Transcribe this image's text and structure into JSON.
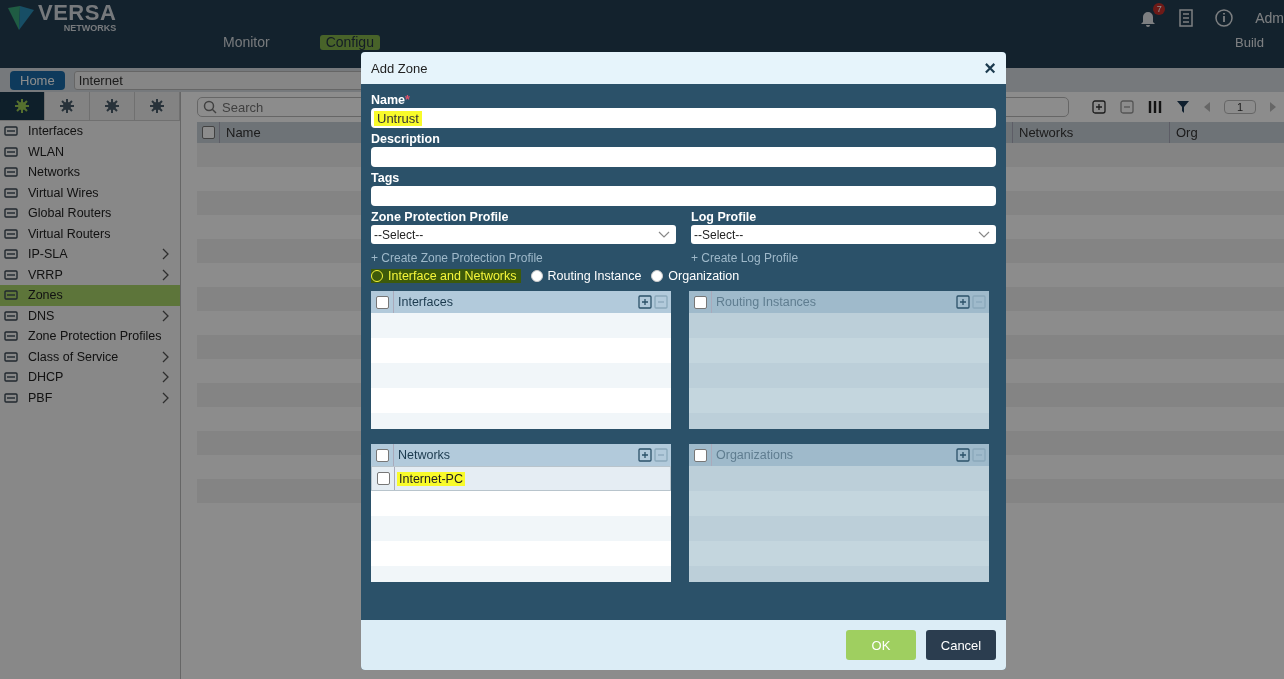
{
  "header": {
    "logo": "VERSA",
    "logo_sub": "NETWORKS",
    "notifications": "7",
    "user": "Adm",
    "nav": [
      {
        "label": "Monitor",
        "selected": false
      },
      {
        "label": "Configu",
        "selected": true
      }
    ],
    "build": "Build"
  },
  "breadcrumb": {
    "home": "Home",
    "appliance": "Internet"
  },
  "sidebar": {
    "tabs": [
      {
        "selected": true
      },
      {
        "selected": false
      },
      {
        "selected": false
      },
      {
        "selected": false
      }
    ],
    "items": [
      {
        "label": "Interfaces",
        "submenu": false,
        "selected": false
      },
      {
        "label": "WLAN",
        "submenu": false,
        "selected": false
      },
      {
        "label": "Networks",
        "submenu": false,
        "selected": false
      },
      {
        "label": "Virtual Wires",
        "submenu": false,
        "selected": false
      },
      {
        "label": "Global Routers",
        "submenu": false,
        "selected": false
      },
      {
        "label": "Virtual Routers",
        "submenu": false,
        "selected": false
      },
      {
        "label": "IP-SLA",
        "submenu": true,
        "selected": false
      },
      {
        "label": "VRRP",
        "submenu": true,
        "selected": false
      },
      {
        "label": "Zones",
        "submenu": false,
        "selected": true
      },
      {
        "label": "DNS",
        "submenu": true,
        "selected": false
      },
      {
        "label": "Zone Protection Profiles",
        "submenu": false,
        "selected": false
      },
      {
        "label": "Class of Service",
        "submenu": true,
        "selected": false
      },
      {
        "label": "DHCP",
        "submenu": true,
        "selected": false
      },
      {
        "label": "PBF",
        "submenu": true,
        "selected": false
      }
    ]
  },
  "main": {
    "search": {
      "placeholder": "Search"
    },
    "page": "1",
    "select_all_checked": false,
    "columns": [
      "Name",
      "Networks",
      "Org"
    ]
  },
  "dialog": {
    "title": "Add Zone",
    "close": "×",
    "name": {
      "label": "Name",
      "required_mark": "*",
      "value": "Untrust",
      "highlight": true
    },
    "description": {
      "label": "Description"
    },
    "tags": {
      "label": "Tags"
    },
    "selects": [
      {
        "label": "Zone Protection Profile",
        "value": "--Select--",
        "link": "+ Create Zone Protection Profile"
      },
      {
        "label": "Log Profile",
        "value": "--Select--",
        "link": "+ Create Log Profile"
      }
    ],
    "radios": [
      {
        "label": "Interface and Networks",
        "selected": true,
        "highlight": true
      },
      {
        "label": "Routing Instance",
        "selected": false,
        "highlight": false
      },
      {
        "label": "Organization",
        "selected": false,
        "highlight": false
      }
    ],
    "lists": [
      {
        "title": "Interfaces",
        "disabled": false,
        "checked": false
      },
      {
        "title": "Routing Instances",
        "disabled": true,
        "checked": false
      },
      {
        "title": "Networks",
        "disabled": false,
        "checked": false,
        "rows": [
          {
            "label": "Internet-PC",
            "highlight": true,
            "checked": false
          }
        ]
      },
      {
        "title": "Organizations",
        "disabled": true,
        "checked": false
      }
    ],
    "buttons": [
      {
        "label": "OK",
        "kind": "primary"
      },
      {
        "label": "Cancel",
        "kind": "secondary"
      }
    ]
  }
}
